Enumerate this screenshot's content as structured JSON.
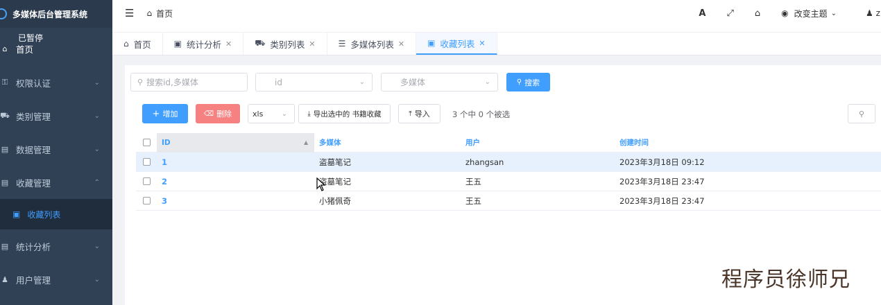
{
  "app": {
    "title": "多媒体后台管理系统",
    "status": "已暂停"
  },
  "sidebar": {
    "items": [
      {
        "label": "首页",
        "icon": "home-icon"
      },
      {
        "label": "权限认证",
        "icon": "key-icon"
      },
      {
        "label": "类别管理",
        "icon": "car-icon"
      },
      {
        "label": "数据管理",
        "icon": "list-icon"
      },
      {
        "label": "收藏管理",
        "icon": "list-icon"
      },
      {
        "label": "收藏列表",
        "icon": "image-icon"
      },
      {
        "label": "统计分析",
        "icon": "list-icon"
      },
      {
        "label": "用户管理",
        "icon": "users-icon"
      }
    ]
  },
  "navbar": {
    "breadcrumb": "首页",
    "font_icon": "A",
    "theme_label": "改变主题",
    "user": "z"
  },
  "tabs": [
    {
      "label": "首页",
      "icon": "home-icon",
      "closable": false
    },
    {
      "label": "统计分析",
      "icon": "image-icon",
      "closable": true
    },
    {
      "label": "类别列表",
      "icon": "car-icon",
      "closable": true
    },
    {
      "label": "多媒体列表",
      "icon": "list-icon",
      "closable": true
    },
    {
      "label": "收藏列表",
      "icon": "image-icon",
      "closable": true,
      "active": true
    }
  ],
  "filters": {
    "search_placeholder": "搜索id,多媒体",
    "id_placeholder": "id",
    "media_placeholder": "多媒体",
    "search_button": "搜索"
  },
  "toolbar": {
    "add": "增加",
    "delete": "删除",
    "format": "xls",
    "export": "导出选中的 书籍收藏",
    "import": "导入",
    "selected_count": "3 个中 0 个被选"
  },
  "table": {
    "headers": {
      "id": "ID",
      "media": "多媒体",
      "user": "用户",
      "created": "创建时间"
    },
    "rows": [
      {
        "id": "1",
        "media": "盗墓笔记",
        "user": "zhangsan",
        "created": "2023年3月18日 09:12"
      },
      {
        "id": "2",
        "media": "盗墓笔记",
        "user": "王五",
        "created": "2023年3月18日 23:47"
      },
      {
        "id": "3",
        "media": "小猪佩奇",
        "user": "王五",
        "created": "2023年3月18日 23:47"
      }
    ]
  },
  "watermark": "程序员徐师兄",
  "colors": {
    "sidebar_bg": "#304156",
    "accent": "#409eff",
    "danger": "#f56c6c"
  }
}
